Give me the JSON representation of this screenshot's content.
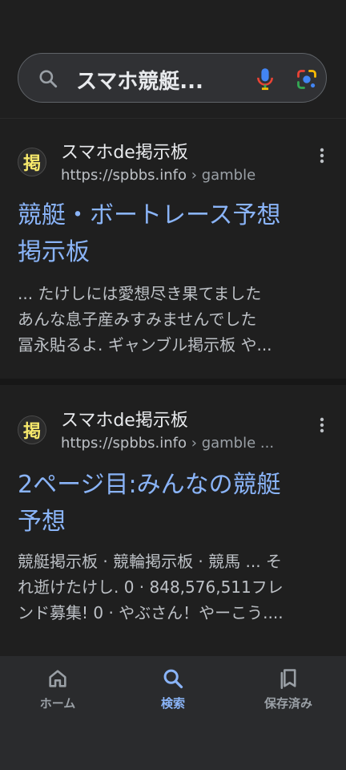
{
  "search": {
    "query": "スマホ競艇..."
  },
  "results": [
    {
      "favicon_char": "掲",
      "site_name": "スマホde掲示板",
      "url": "https://spbbs.info",
      "breadcrumb": " › gamble",
      "title_line1": "競艇・ボートレース予想",
      "title_line2": "掲示板",
      "snippet_line1": "... たけしには愛想尽き果てました",
      "snippet_line2": "あんな息子産みすみませんでした",
      "snippet_line3": "冨永貼るよ. ギャンブル掲示板 や..."
    },
    {
      "favicon_char": "掲",
      "site_name": "スマホde掲示板",
      "url": "https://spbbs.info",
      "breadcrumb": " › gamble ...",
      "title_line1": "2ページ目:みんなの競艇",
      "title_line2": "予想",
      "snippet_line1": "競艇掲示板 · 競輪掲示板 · 競馬 ... そ",
      "snippet_line2": "れ逝けたけし. 0 · 848,576,511フレ",
      "snippet_line3": "ンド募集! 0 · やぶさん！やーこう...."
    }
  ],
  "nav": {
    "home": "ホーム",
    "search": "検索",
    "saved": "保存済み"
  },
  "colors": {
    "background": "#1f1f1f",
    "link": "#8ab4f8",
    "active_nav": "#8ab4f8"
  }
}
